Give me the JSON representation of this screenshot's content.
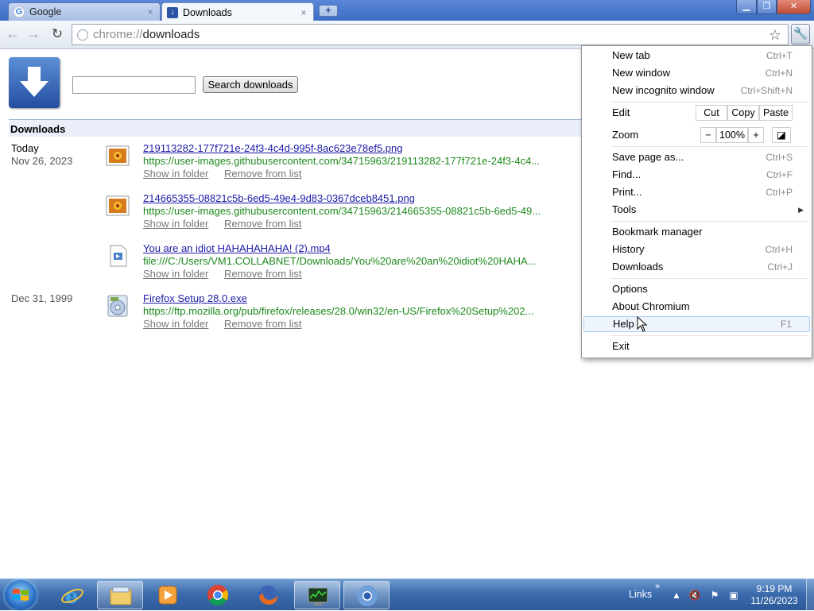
{
  "tabs": [
    {
      "label": "Google",
      "close": "×"
    },
    {
      "label": "Downloads",
      "close": "×"
    }
  ],
  "window_controls": {
    "minimize": "▁",
    "maximize": "❐",
    "close": "✕"
  },
  "toolbar": {
    "url_scheme": "chrome://",
    "url_host": "downloads"
  },
  "page": {
    "search_placeholder": "",
    "search_button": "Search downloads",
    "section_title": "Downloads",
    "groups": [
      {
        "date_label": "Today",
        "date_sub": "Nov 26, 2023"
      },
      {
        "date_label": "Dec 31, 1999",
        "date_sub": ""
      }
    ],
    "items": [
      {
        "name": "219113282-177f721e-24f3-4c4d-995f-8ac623e78ef5.png",
        "url": "https://user-images.githubusercontent.com/34715963/219113282-177f721e-24f3-4c4...",
        "show": "Show in folder",
        "remove": "Remove from list",
        "icon": "image-file-icon"
      },
      {
        "name": "214665355-08821c5b-6ed5-49e4-9d83-0367dceb8451.png",
        "url": "https://user-images.githubusercontent.com/34715963/214665355-08821c5b-6ed5-49...",
        "show": "Show in folder",
        "remove": "Remove from list",
        "icon": "image-file-icon"
      },
      {
        "name": "You are an idiot HAHAHAHAHA! (2).mp4",
        "url": "file:///C:/Users/VM1.COLLABNET/Downloads/You%20are%20an%20idiot%20HAHA...",
        "show": "Show in folder",
        "remove": "Remove from list",
        "icon": "video-file-icon"
      },
      {
        "name": "Firefox Setup 28.0.exe",
        "url": "https://ftp.mozilla.org/pub/firefox/releases/28.0/win32/en-US/Firefox%20Setup%202...",
        "show": "Show in folder",
        "remove": "Remove from list",
        "icon": "installer-file-icon"
      }
    ]
  },
  "menu": {
    "new_tab": {
      "label": "New tab",
      "shortcut": "Ctrl+T"
    },
    "new_window": {
      "label": "New window",
      "shortcut": "Ctrl+N"
    },
    "new_incognito": {
      "label": "New incognito window",
      "shortcut": "Ctrl+Shift+N"
    },
    "edit": {
      "label": "Edit",
      "cut": "Cut",
      "copy": "Copy",
      "paste": "Paste"
    },
    "zoom": {
      "label": "Zoom",
      "minus": "−",
      "value": "100%",
      "plus": "+"
    },
    "save_page": {
      "label": "Save page as...",
      "shortcut": "Ctrl+S"
    },
    "find": {
      "label": "Find...",
      "shortcut": "Ctrl+F"
    },
    "print": {
      "label": "Print...",
      "shortcut": "Ctrl+P"
    },
    "tools": {
      "label": "Tools",
      "submenu": "▶"
    },
    "bookmark_manager": {
      "label": "Bookmark manager"
    },
    "history": {
      "label": "History",
      "shortcut": "Ctrl+H"
    },
    "downloads": {
      "label": "Downloads",
      "shortcut": "Ctrl+J"
    },
    "options": {
      "label": "Options"
    },
    "about": {
      "label": "About Chromium"
    },
    "help": {
      "label": "Help",
      "shortcut": "F1"
    },
    "exit": {
      "label": "Exit"
    }
  },
  "taskbar": {
    "apps": [
      "internet-explorer",
      "windows-explorer",
      "media-player",
      "chrome",
      "firefox",
      "task-manager",
      "chromium"
    ],
    "links_label": "Links",
    "chevron": "»",
    "clock_time": "9:19 PM",
    "clock_date": "11/26/2023"
  },
  "colors": {
    "link": "#1a1aa6",
    "url_green": "#1d8a1d",
    "section_bg": "#ebeff9",
    "menu_hover": "#eef4fc"
  }
}
